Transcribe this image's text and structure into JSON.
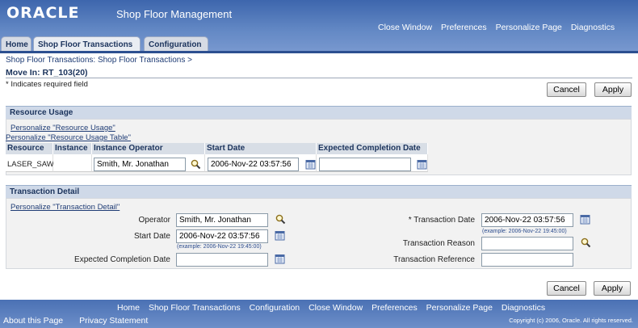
{
  "header": {
    "logo": "ORACLE",
    "app_name": "Shop Floor Management",
    "global_links": [
      "Close Window",
      "Preferences",
      "Personalize Page",
      "Diagnostics"
    ]
  },
  "tabs": [
    {
      "label": "Home",
      "active": false
    },
    {
      "label": "Shop Floor Transactions",
      "active": true
    },
    {
      "label": "Configuration",
      "active": false
    }
  ],
  "breadcrumb": "Shop Floor Transactions: Shop Floor Transactions  >",
  "page_title": "Move In: RT_103(20)",
  "required_note": "* Indicates required field",
  "buttons": {
    "cancel": "Cancel",
    "apply": "Apply"
  },
  "resource_usage": {
    "title": "Resource Usage",
    "personalize_link": "Personalize \"Resource Usage\"",
    "personalize_table_link": "Personalize \"Resource Usage Table\"",
    "columns": [
      "Resource",
      "Instance",
      "Instance Operator",
      "Start Date",
      "Expected Completion Date"
    ],
    "row": {
      "resource": "LASER_SAW",
      "instance": "",
      "instance_operator": "Smith, Mr. Jonathan",
      "start_date": "2006-Nov-22 03:57:56",
      "expected_completion_date": ""
    }
  },
  "transaction_detail": {
    "title": "Transaction Detail",
    "personalize_link": "Personalize \"Transaction Detail\"",
    "operator_label": "Operator",
    "operator_value": "Smith, Mr. Jonathan",
    "start_date_label": "Start Date",
    "start_date_value": "2006-Nov-22 03:57:56",
    "start_date_hint": "(example: 2006-Nov-22 19:45:00)",
    "expected_completion_label": "Expected Completion Date",
    "expected_completion_value": "",
    "transaction_date_label": "* Transaction Date",
    "transaction_date_value": "2006-Nov-22 03:57:56",
    "transaction_date_hint": "(example: 2006-Nov-22 19:45:00)",
    "transaction_reason_label": "Transaction Reason",
    "transaction_reason_value": "",
    "transaction_reference_label": "Transaction Reference",
    "transaction_reference_value": ""
  },
  "footer": {
    "links": [
      "Home",
      "Shop Floor Transactions",
      "Configuration",
      "Close Window",
      "Preferences",
      "Personalize Page",
      "Diagnostics"
    ],
    "about": "About this Page",
    "privacy": "Privacy Statement",
    "copyright": "Copyright (c) 2006, Oracle. All rights reserved."
  },
  "colors": {
    "header_blue": "#5a80be",
    "title_navy": "#1b335c",
    "link_blue": "#1f3c75"
  }
}
